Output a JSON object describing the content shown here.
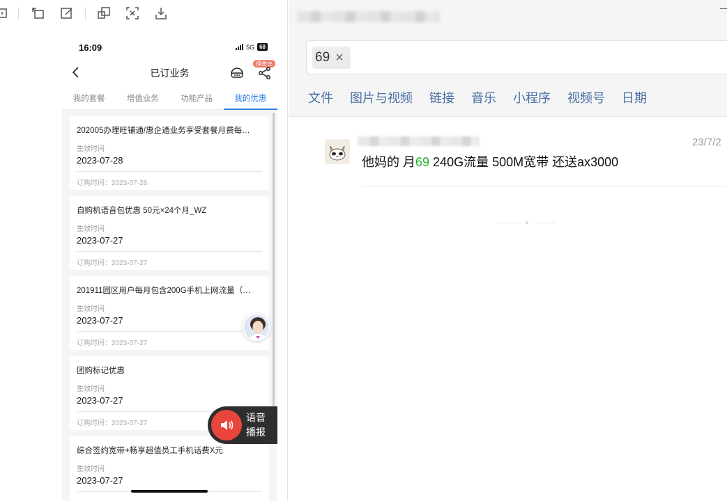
{
  "phone": {
    "status": {
      "time": "16:09",
      "network": "5G",
      "battery": "68"
    },
    "nav": {
      "title": "已订业务",
      "badge": "得金豆"
    },
    "tabs": [
      "我的套餐",
      "增值业务",
      "功能产品",
      "我的优惠"
    ],
    "active_tab": 3,
    "cards": [
      {
        "title": "202005办理旺铺通/惠企通业务享受套餐月费每…",
        "eff_label": "生效时间",
        "eff_date": "2023-07-28",
        "order": "订购时间：2023-07-28"
      },
      {
        "title": "自购机语音包优惠 50元×24个月_WZ",
        "eff_label": "生效时间",
        "eff_date": "2023-07-27",
        "order": "订购时间：2023-07-27"
      },
      {
        "title": "201911园区用户每月包含200G手机上网流量（…",
        "eff_label": "生效时间",
        "eff_date": "2023-07-27",
        "order": "订购时间：2023-07-27"
      },
      {
        "title": "团购标记优惠",
        "eff_label": "生效时间",
        "eff_date": "2023-07-27",
        "order": "订购时间：2023-07-27"
      },
      {
        "title": "综合签约宽带+畅享超值员工手机话费X元",
        "eff_label": "生效时间",
        "eff_date": "2023-07-27",
        "order": ""
      }
    ],
    "voice": {
      "line1": "语音",
      "line2": "播报"
    }
  },
  "search": {
    "query": "69",
    "filters": [
      "文件",
      "图片与视频",
      "链接",
      "音乐",
      "小程序",
      "视频号",
      "日期"
    ]
  },
  "result": {
    "date": "23/7/2",
    "text_before": "他妈的 月",
    "highlight": "69",
    "text_after": " 240G流量 500M宽带 还送ax3000"
  },
  "colors": {
    "tab_active": "#2b7be4",
    "filter_link": "#4a6fa5",
    "highlight": "#2aae2a",
    "voice_button": "#e8453c"
  }
}
